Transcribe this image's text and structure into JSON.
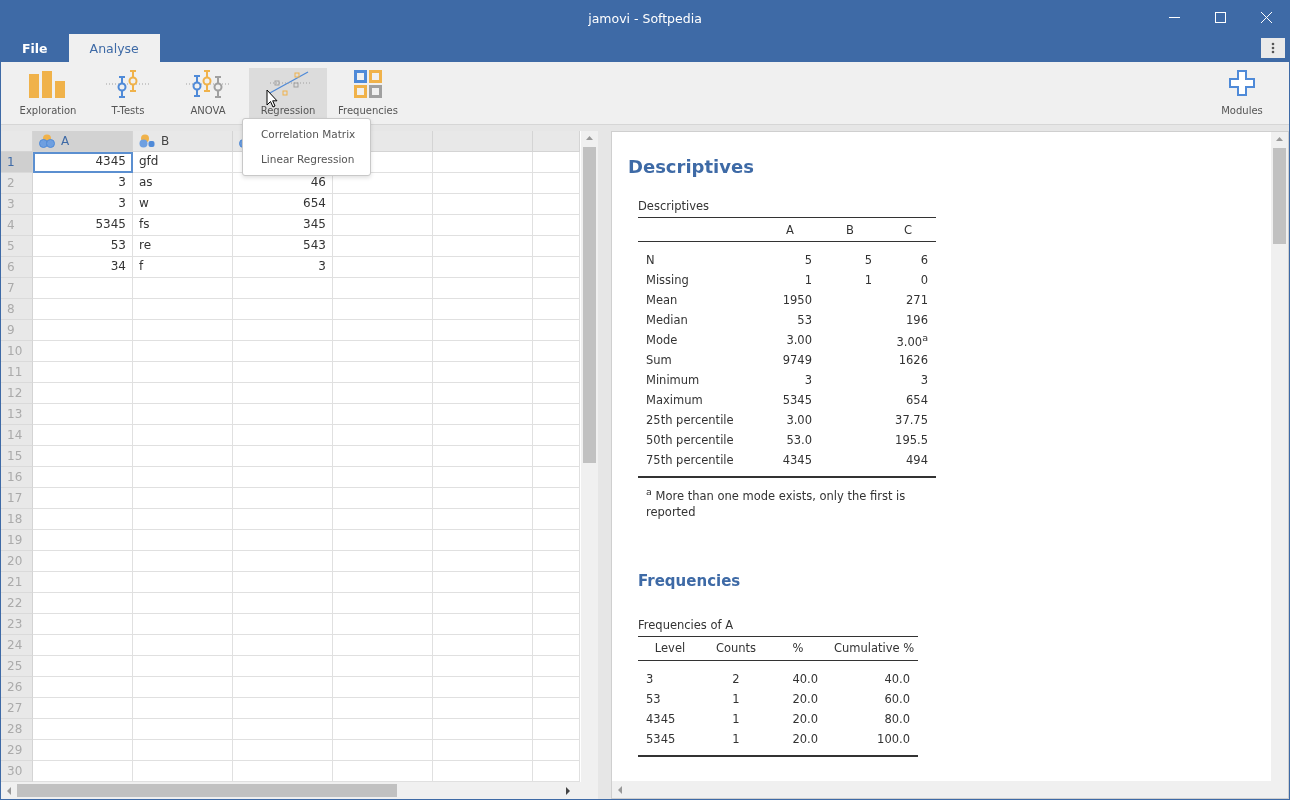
{
  "window": {
    "title": "jamovi - Softpedia"
  },
  "menu_tabs": [
    {
      "label": "File",
      "selected": false
    },
    {
      "label": "Analyse",
      "selected": true
    }
  ],
  "ribbon": {
    "items": [
      {
        "label": "Exploration",
        "kind": "exploration",
        "selected": false
      },
      {
        "label": "T-Tests",
        "kind": "ttests",
        "selected": false
      },
      {
        "label": "ANOVA",
        "kind": "anova",
        "selected": false
      },
      {
        "label": "Regression",
        "kind": "regression",
        "selected": true
      },
      {
        "label": "Frequencies",
        "kind": "frequencies",
        "selected": false
      }
    ],
    "modules": {
      "label": "Modules"
    }
  },
  "dropdown": {
    "items": [
      "Correlation Matrix",
      "Linear Regression"
    ]
  },
  "spreadsheet": {
    "columns": [
      {
        "name": "A",
        "kind": "continuous",
        "selected": true
      },
      {
        "name": "B",
        "kind": "nominal",
        "selected": false
      },
      {
        "kind": "continuous",
        "selected": false
      }
    ],
    "rows": [
      {
        "number": "1",
        "selected": true,
        "cells": [
          "4345",
          "gfd"
        ]
      },
      {
        "number": "2",
        "selected": false,
        "cells": [
          "3",
          "as",
          "46"
        ]
      },
      {
        "number": "3",
        "selected": false,
        "cells": [
          "3",
          "w",
          "654"
        ]
      },
      {
        "number": "4",
        "selected": false,
        "cells": [
          "5345",
          "fs",
          "345"
        ]
      },
      {
        "number": "5",
        "selected": false,
        "cells": [
          "53",
          "re",
          "543"
        ]
      },
      {
        "number": "6",
        "selected": false,
        "cells": [
          "34",
          "f",
          "3"
        ]
      },
      {
        "number": "7",
        "selected": false
      },
      {
        "number": "8",
        "selected": false
      },
      {
        "number": "9",
        "selected": false
      },
      {
        "number": "10",
        "selected": false
      },
      {
        "number": "11",
        "selected": false
      },
      {
        "number": "12",
        "selected": false
      },
      {
        "number": "13",
        "selected": false
      },
      {
        "number": "14",
        "selected": false
      },
      {
        "number": "15",
        "selected": false
      },
      {
        "number": "16",
        "selected": false
      },
      {
        "number": "17",
        "selected": false
      },
      {
        "number": "18",
        "selected": false
      },
      {
        "number": "19",
        "selected": false
      },
      {
        "number": "20",
        "selected": false
      },
      {
        "number": "21",
        "selected": false
      },
      {
        "number": "22",
        "selected": false
      },
      {
        "number": "23",
        "selected": false
      },
      {
        "number": "24",
        "selected": false
      },
      {
        "number": "25",
        "selected": false
      },
      {
        "number": "26",
        "selected": false
      },
      {
        "number": "27",
        "selected": false
      },
      {
        "number": "28",
        "selected": false
      },
      {
        "number": "29",
        "selected": false
      },
      {
        "number": "30",
        "selected": false
      }
    ]
  },
  "results": {
    "descriptives": {
      "heading": "Descriptives",
      "table_title": "Descriptives",
      "columns": [
        "A",
        "B",
        "C"
      ],
      "rows": [
        {
          "label": "N",
          "a": "5",
          "b": "5",
          "c": "6"
        },
        {
          "label": "Missing",
          "a": "1",
          "b": "1",
          "c": "0"
        },
        {
          "label": "Mean",
          "a": "1950",
          "c": "271"
        },
        {
          "label": "Median",
          "a": "53",
          "c": "196"
        },
        {
          "label": "Mode",
          "a": "3.00",
          "c": "3.00$^{a}$"
        },
        {
          "label": "Sum",
          "a": "9749",
          "c": "1626"
        },
        {
          "label": "Minimum",
          "a": "3",
          "c": "3"
        },
        {
          "label": "Maximum",
          "a": "5345",
          "c": "654"
        },
        {
          "label": "25th percentile",
          "a": "3.00",
          "c": "37.75"
        },
        {
          "label": "50th percentile",
          "a": "53.0",
          "c": "195.5"
        },
        {
          "label": "75th percentile",
          "a": "4345",
          "c": "494"
        }
      ],
      "footnote": "$^{a}$ More than one mode exists, only the first is reported"
    },
    "frequencies": {
      "heading": "Frequencies",
      "table_title": "Frequencies of A",
      "columns": [
        "Level",
        "Counts",
        "%",
        "Cumulative %"
      ],
      "rows": [
        [
          "3",
          "2",
          "40.0",
          "40.0"
        ],
        [
          "53",
          "1",
          "20.0",
          "60.0"
        ],
        [
          "4345",
          "1",
          "20.0",
          "80.0"
        ],
        [
          "5345",
          "1",
          "20.0",
          "100.0"
        ]
      ]
    }
  }
}
